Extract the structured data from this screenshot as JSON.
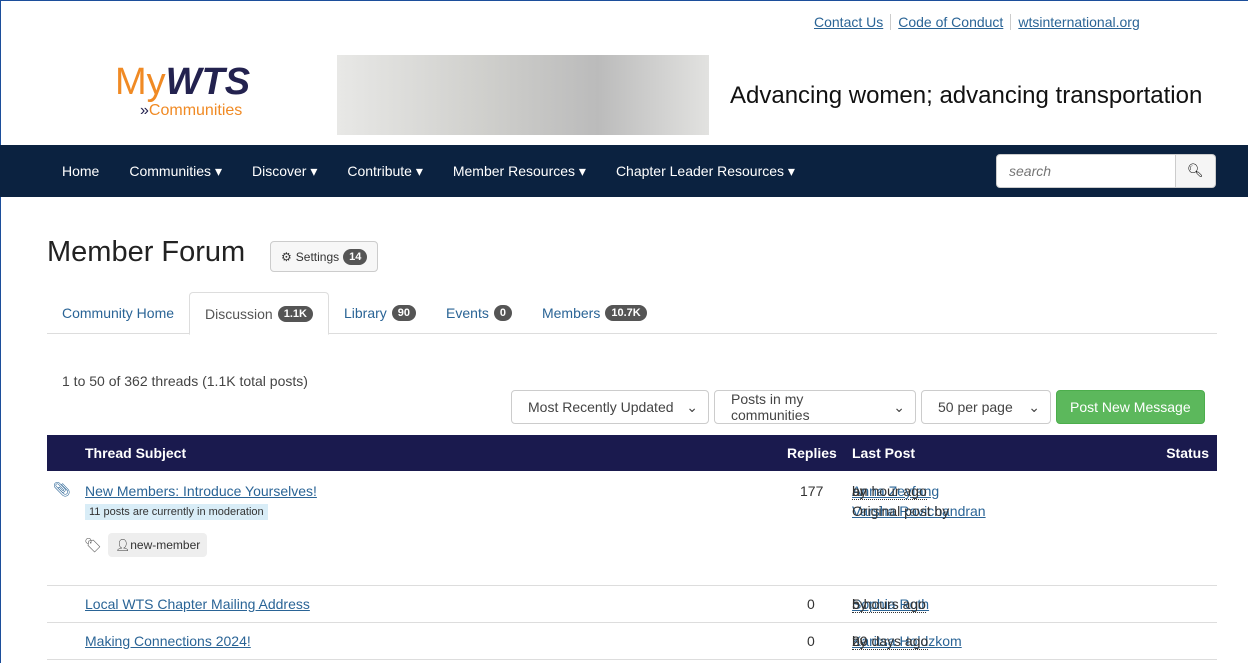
{
  "top_links": [
    "Contact Us",
    "Code of Conduct",
    "wtsinternational.org"
  ],
  "logo": {
    "text": "MyWTS",
    "sub": "Communities"
  },
  "tagline": "Advancing women; advancing transportation",
  "nav": [
    "Home",
    "Communities ▾",
    "Discover ▾",
    "Contribute ▾",
    "Member Resources ▾",
    "Chapter Leader Resources ▾"
  ],
  "search_placeholder": "search",
  "title": "Member Forum",
  "settings": {
    "label": "Settings",
    "count": "14"
  },
  "tabs": [
    {
      "label": "Community Home"
    },
    {
      "label": "Discussion",
      "count": "1.1K"
    },
    {
      "label": "Library",
      "count": "90"
    },
    {
      "label": "Events",
      "count": "0"
    },
    {
      "label": "Members",
      "count": "10.7K"
    }
  ],
  "summary": "1 to 50 of 362 threads (1.1K total posts)",
  "controls": {
    "sort": "Most Recently Updated",
    "filter": "Posts in my communities",
    "per_page": "50 per page",
    "post": "Post New Message"
  },
  "columns": [
    "Thread Subject",
    "Replies",
    "Last Post",
    "Status"
  ],
  "threads": [
    {
      "subject": "New Members: Introduce Yourselves!",
      "moderation": "11 posts are currently in moderation",
      "tag": "new-member",
      "replies": "177",
      "time": "an hour ago",
      "by": "by",
      "author": "Anna Zeyfang",
      "original": "Original post by",
      "original_author": "Varsha Ravichandran"
    },
    {
      "subject": "Local WTS Chapter Mailing Address",
      "replies": "0",
      "time": "5 hours ago",
      "by": "by",
      "author": "Sophia Roth"
    },
    {
      "subject": "Making Connections 2024!",
      "replies": "0",
      "time": "20 days ago",
      "by": "by",
      "author": "Karitsa Holdzkom"
    }
  ]
}
